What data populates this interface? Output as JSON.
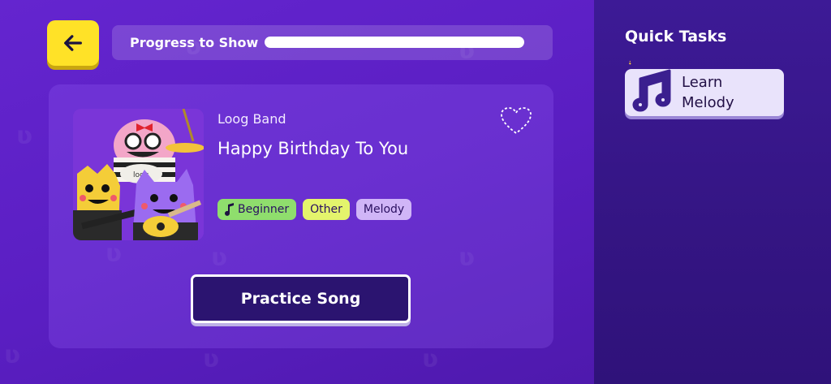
{
  "header": {
    "progress_label": "Progress to Show",
    "progress_value": 1.0
  },
  "song": {
    "artist": "Loog Band",
    "title": "Happy Birthday To You",
    "tags": [
      "Beginner",
      "Other",
      "Melody"
    ],
    "practice_label": "Practice Song"
  },
  "quick_tasks": {
    "title": "Quick Tasks",
    "items": [
      {
        "label": "Learn Melody",
        "icon": "music-note-icon"
      }
    ]
  },
  "colors": {
    "background": "#5a1fc4",
    "side_panel": "#3d1a96",
    "back_button": "#ffe227",
    "practice_button": "#2b1470",
    "tag_beginner": "#8fde6d",
    "tag_other": "#e4f46c",
    "tag_melody": "#d0b5f7"
  }
}
